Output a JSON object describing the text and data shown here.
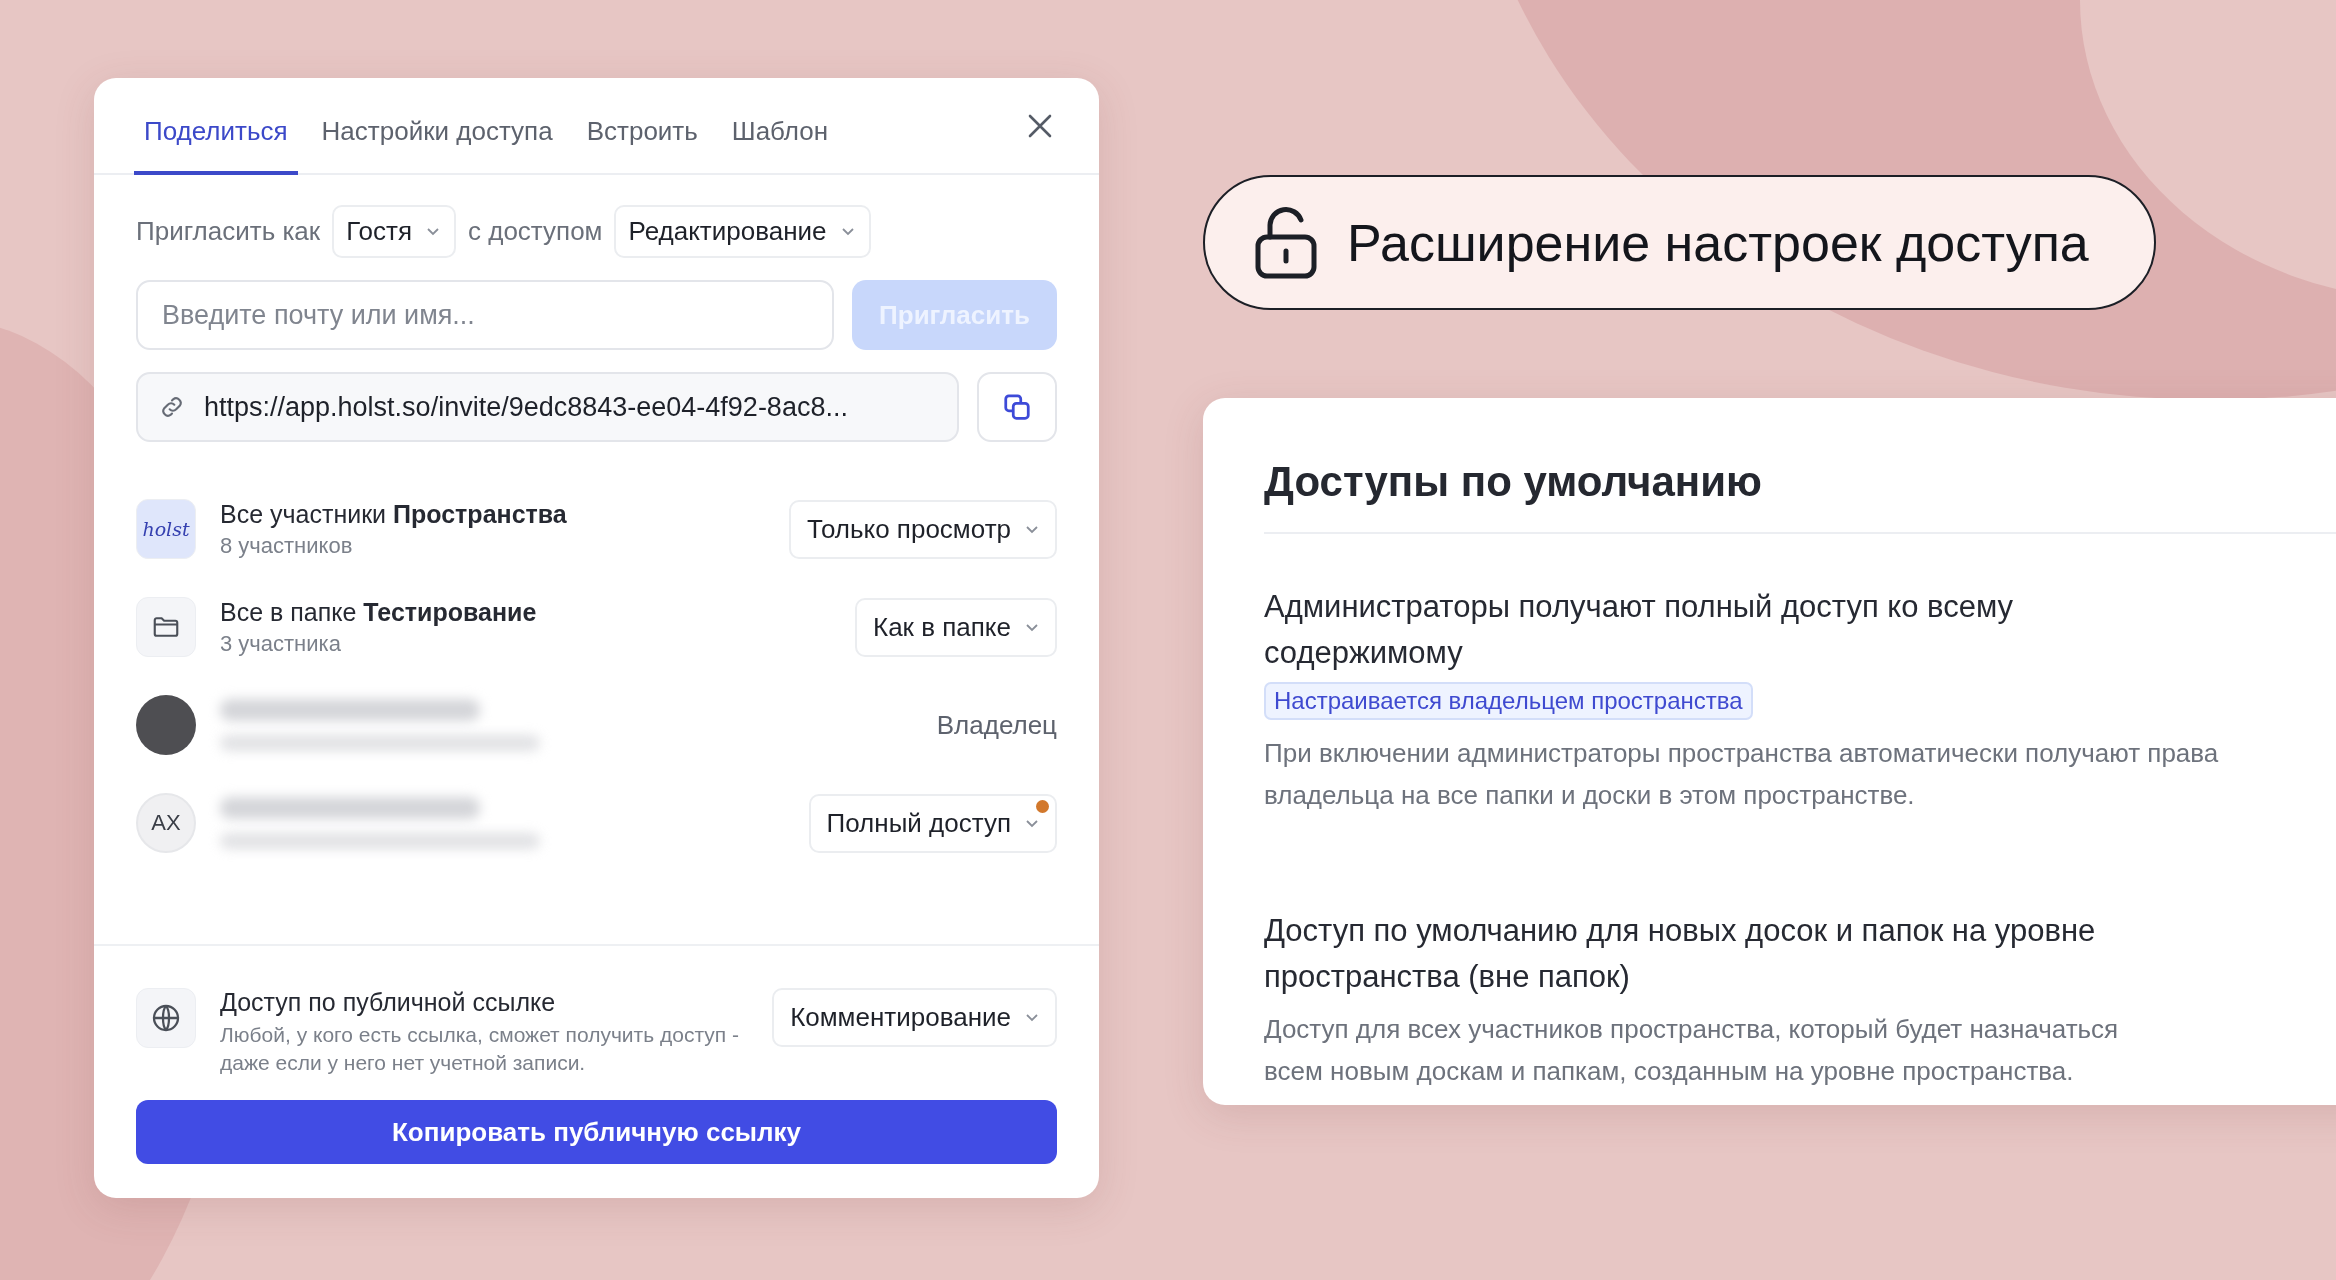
{
  "dialog": {
    "tabs": [
      {
        "label": "Поделиться",
        "selected": true
      },
      {
        "label": "Настройки доступа",
        "selected": false
      },
      {
        "label": "Встроить",
        "selected": false
      },
      {
        "label": "Шаблон",
        "selected": false
      }
    ],
    "invite": {
      "label_as": "Пригласить как",
      "role": "Гостя",
      "label_access": "с доступом",
      "access": "Редактирование",
      "placeholder": "Введите почту или имя...",
      "button": "Пригласить",
      "button_disabled": true
    },
    "link": {
      "url": "https://app.holst.so/invite/9edc8843-ee04-4f92-8ac8..."
    },
    "members": [
      {
        "kind": "workspace",
        "logo": "holst",
        "title": "Все участники **Пространства**",
        "subtitle": "8 участников",
        "access": "Только просмотр",
        "dropdown": true,
        "notice": false
      },
      {
        "kind": "folder",
        "title": "Все в папке **Тестирование**",
        "subtitle": "3 участника",
        "access": "Как в папке",
        "dropdown": true,
        "notice": false
      },
      {
        "kind": "photo",
        "access": "Владелец",
        "dropdown": false,
        "notice": false
      },
      {
        "kind": "initials",
        "initials": "АХ",
        "access": "Полный доступ",
        "dropdown": true,
        "notice": true
      }
    ],
    "public": {
      "title": "Доступ по публичной ссылке",
      "description": "Любой, у кого есть ссылка, сможет получить доступ - даже если у него нет учетной записи.",
      "access": "Комментирование"
    },
    "copy_button": "Копировать публичную ссылку"
  },
  "banner": {
    "title": "Расширение настроек доступа"
  },
  "settings_card": {
    "title": "Доступы по умолчанию",
    "sections": [
      {
        "title": "Администраторы получают полный доступ ко всему содержимому",
        "badge": "Настраивается владельцем пространства",
        "description": "При включении администраторы пространства автоматически получают права владельца на все папки и доски в этом пространстве."
      },
      {
        "title": "Доступ по умолчанию для новых досок и папок на уровне пространства (вне папок)",
        "description": "Доступ для всех участников пространства, который будет назначаться всем новым доскам и папкам, созданным на уровне пространства."
      }
    ]
  }
}
